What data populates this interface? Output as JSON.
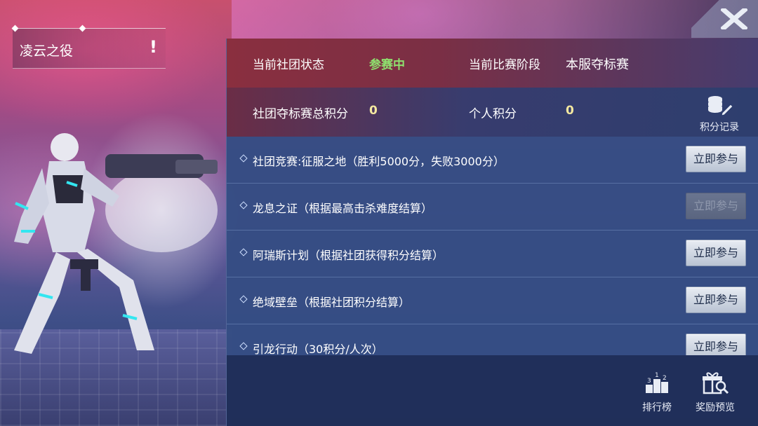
{
  "event": {
    "title": "凌云之役",
    "info_icon": "!"
  },
  "close": {
    "label": "X"
  },
  "status": {
    "club_status_label": "当前社团状态",
    "club_status_value": "参赛中",
    "match_stage_label": "当前比赛阶段",
    "match_stage_value": "本服夺标赛",
    "club_points_label": "社团夺标赛总积分",
    "club_points_value": "0",
    "personal_points_label": "个人积分",
    "personal_points_value": "0",
    "points_log_label": "积分记录"
  },
  "activities": [
    {
      "text": "社团竞赛:征服之地（胜利5000分，失败3000分）",
      "button": "立即参与",
      "enabled": true
    },
    {
      "text": "龙息之证（根据最高击杀难度结算）",
      "button": "立即参与",
      "enabled": false
    },
    {
      "text": "阿瑞斯计划（根据社团获得积分结算）",
      "button": "立即参与",
      "enabled": true
    },
    {
      "text": "绝域壁垒（根据社团积分结算）",
      "button": "立即参与",
      "enabled": true
    },
    {
      "text": "引龙行动（30积分/人次）",
      "button": "立即参与",
      "enabled": true
    }
  ],
  "bottom": {
    "ranking_label": "排行榜",
    "rewards_label": "奖励预览"
  },
  "colors": {
    "active_status": "#8ee06e",
    "points_value": "#f5e9a0",
    "panel": "#2a3c6e"
  }
}
